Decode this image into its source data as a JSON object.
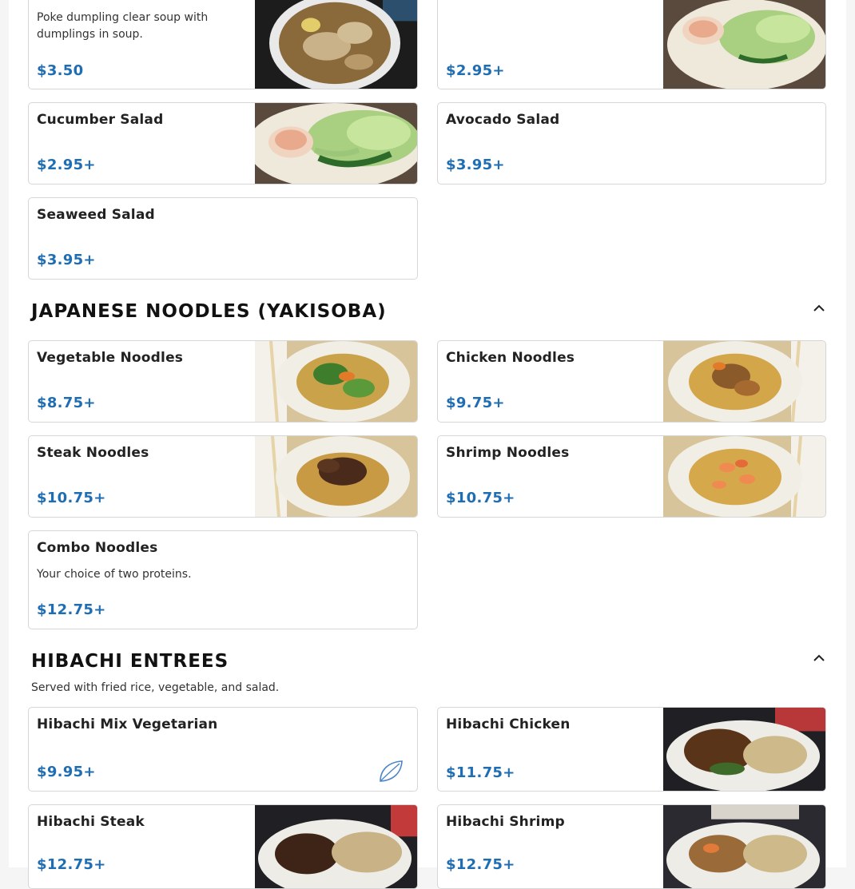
{
  "soup_salad": {
    "items": [
      {
        "name": "",
        "desc": "Poke dumpling clear soup with dumplings in soup.",
        "price": "$3.50"
      },
      {
        "name": "",
        "price": "$2.95+"
      },
      {
        "name": "Cucumber Salad",
        "price": "$2.95+"
      },
      {
        "name": "Avocado Salad",
        "price": "$3.95+"
      },
      {
        "name": "Seaweed Salad",
        "price": "$3.95+"
      }
    ]
  },
  "noodles": {
    "title": "JAPANESE NOODLES (YAKISOBA)",
    "collapse_icon": "chevron-up-icon",
    "items": [
      {
        "name": "Vegetable Noodles",
        "price": "$8.75+"
      },
      {
        "name": "Chicken Noodles",
        "price": "$9.75+"
      },
      {
        "name": "Steak Noodles",
        "price": "$10.75+"
      },
      {
        "name": "Shrimp Noodles",
        "price": "$10.75+"
      },
      {
        "name": "Combo Noodles",
        "desc": "Your choice of two proteins.",
        "price": "$12.75+"
      }
    ]
  },
  "hibachi": {
    "title": "HIBACHI ENTREES",
    "subtitle": "Served with fried rice, vegetable, and salad.",
    "collapse_icon": "chevron-up-icon",
    "items": [
      {
        "name": "Hibachi Mix Vegetarian",
        "price": "$9.95+",
        "badge_icon": "leaf-icon"
      },
      {
        "name": "Hibachi Chicken",
        "price": "$11.75+"
      },
      {
        "name": "Hibachi Steak",
        "price": "$12.75+"
      },
      {
        "name": "Hibachi Shrimp",
        "price": "$12.75+"
      }
    ]
  },
  "colors": {
    "price": "#1f6db3",
    "border": "#d6d6d6",
    "title": "#111111"
  }
}
